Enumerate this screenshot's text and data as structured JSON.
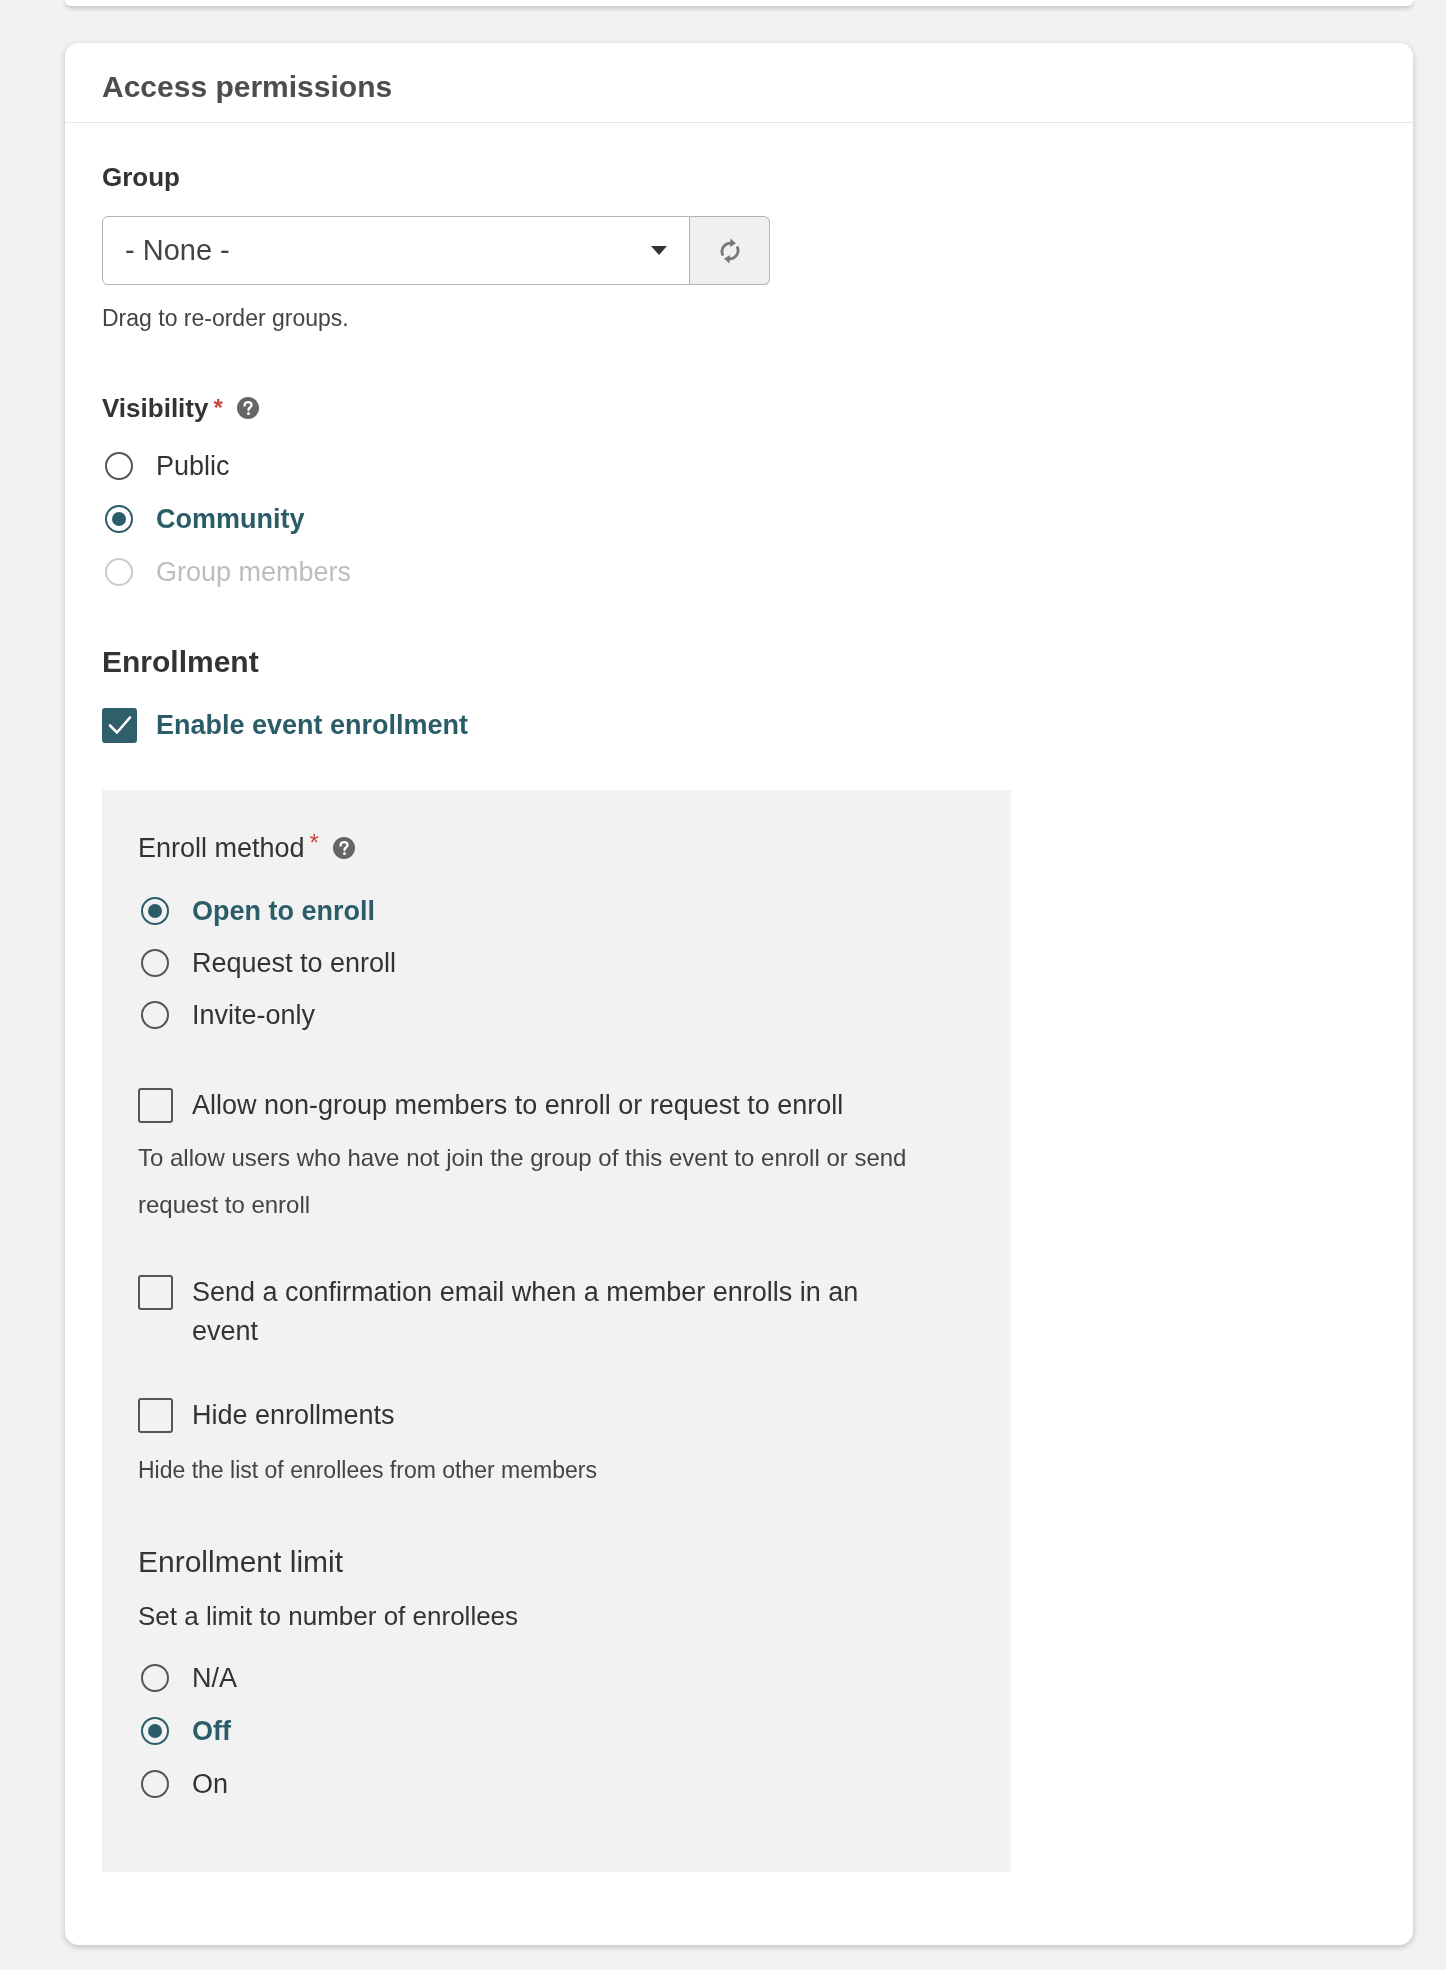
{
  "card": {
    "title": "Access permissions"
  },
  "group": {
    "label": "Group",
    "value": "- None -",
    "help": "Drag to re-order groups."
  },
  "visibility": {
    "label": "Visibility",
    "required_mark": "*",
    "options": [
      {
        "label": "Public",
        "selected": false,
        "disabled": false
      },
      {
        "label": "Community",
        "selected": true,
        "disabled": false
      },
      {
        "label": "Group members",
        "selected": false,
        "disabled": true
      }
    ]
  },
  "enrollment": {
    "heading": "Enrollment",
    "enable": {
      "label": "Enable event enrollment",
      "checked": true
    },
    "method": {
      "label": "Enroll method",
      "required_mark": "*",
      "options": [
        {
          "label": "Open to enroll",
          "selected": true
        },
        {
          "label": "Request to enroll",
          "selected": false
        },
        {
          "label": "Invite-only",
          "selected": false
        }
      ]
    },
    "checkboxes": [
      {
        "label": "Allow non-group members to enroll or request to enroll",
        "checked": false,
        "description": "To allow users who have not join the group of this event to enroll or send request to enroll"
      },
      {
        "label": "Send a confirmation email when a member enrolls in an event",
        "checked": false
      },
      {
        "label": "Hide enrollments",
        "checked": false,
        "description": "Hide the list of enrollees from other members"
      }
    ],
    "limit": {
      "heading": "Enrollment limit",
      "description": "Set a limit to number of enrollees",
      "options": [
        {
          "label": "N/A",
          "selected": false
        },
        {
          "label": "Off",
          "selected": true
        },
        {
          "label": "On",
          "selected": false
        }
      ]
    }
  }
}
